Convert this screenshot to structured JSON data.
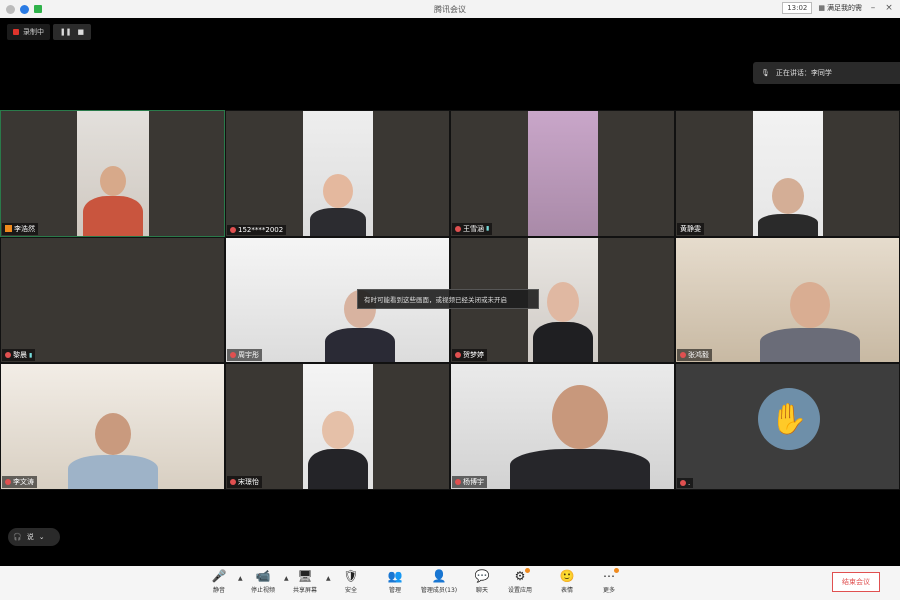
{
  "titlebar": {
    "title": "腾讯会议",
    "time_box": "13:02",
    "link_label": "满足我的需",
    "minimize": "–",
    "close": "×"
  },
  "recording": {
    "label": "录制中",
    "pause": "❚❚",
    "stop": "■"
  },
  "speaking": {
    "label": "正在讲话：李同学"
  },
  "tiles": [
    {
      "name": "李浩然",
      "muted": false
    },
    {
      "name": "152****2002",
      "muted": true
    },
    {
      "name": "王雪涵",
      "muted": true
    },
    {
      "name": "黄静雯",
      "muted": false
    },
    {
      "name": "黎晨",
      "muted": true
    },
    {
      "name": "周宇彤",
      "muted": true
    },
    {
      "name": "贺梦婷",
      "muted": true
    },
    {
      "name": "张鸿毅",
      "muted": true
    },
    {
      "name": "李文涛",
      "muted": true
    },
    {
      "name": "宋璟怡",
      "muted": true
    },
    {
      "name": "杨博宇",
      "muted": true
    },
    {
      "name": ".",
      "muted": true
    }
  ],
  "tooltip": "有时可能看到这些画面，或视频已经关闭或未开启",
  "audio_pill": {
    "label": "说"
  },
  "toolbar": {
    "items": [
      {
        "icon": "🎤",
        "label": "静音"
      },
      {
        "icon": "📹",
        "label": "停止视频"
      },
      {
        "icon": "🖥",
        "label": "共享屏幕"
      },
      {
        "icon": "🛡",
        "label": "安全"
      },
      {
        "icon": "👥",
        "label": "管理"
      },
      {
        "icon": "👤",
        "label": "管理成员(13)"
      },
      {
        "icon": "💬",
        "label": "聊天"
      },
      {
        "icon": "⚙",
        "label": "设置应用"
      },
      {
        "icon": "🙂",
        "label": "表情"
      },
      {
        "icon": "⋯",
        "label": "更多"
      }
    ],
    "leave": "结束会议"
  }
}
